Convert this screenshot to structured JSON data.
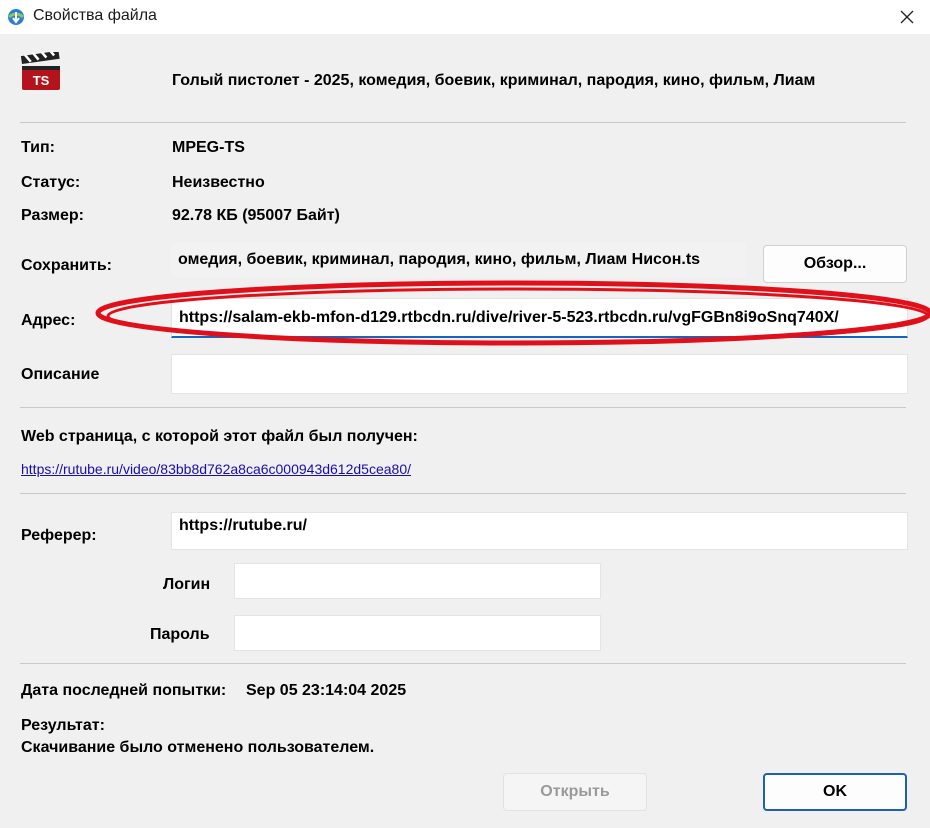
{
  "window": {
    "title": "Свойства файла",
    "app_icon": "idm-globe-icon",
    "close_icon": "close-icon"
  },
  "file": {
    "icon": "ts-clapperboard-icon",
    "icon_text": "TS",
    "title": "Голый пистолет - 2025, комедия, боевик, криминал, пародия, кино, фильм, Лиам"
  },
  "info": {
    "type_label": "Тип:",
    "type_value": "MPEG-TS",
    "status_label": "Статус:",
    "status_value": "Неизвестно",
    "size_label": "Размер:",
    "size_value": "92.78  КБ (95007 Байт)"
  },
  "save": {
    "label": "Сохранить:",
    "value": "омедия, боевик, криминал, пародия, кино, фильм, Лиам Нисон.ts",
    "browse_label": "Обзор..."
  },
  "address": {
    "label": "Адрес:",
    "value": "https://salam-ekb-mfon-d129.rtbcdn.ru/dive/river-5-523.rtbcdn.ru/vgFGBn8i9oSnq740X/"
  },
  "description": {
    "label": "Описание",
    "value": ""
  },
  "webpage": {
    "label": "Web страница, с которой этот файл был получен:",
    "link": "https://rutube.ru/video/83bb8d762a8ca6c000943d612d5cea80/"
  },
  "referrer": {
    "label": "Реферер:",
    "value": "https://rutube.ru/"
  },
  "login": {
    "label": "Логин",
    "value": ""
  },
  "password": {
    "label": "Пароль",
    "value": ""
  },
  "last_attempt": {
    "label": "Дата последней попытки:",
    "value": "Sep 05 23:14:04 2025"
  },
  "result": {
    "label": "Результат:",
    "value": "Скачивание было отменено пользователем."
  },
  "buttons": {
    "open_label": "Открыть",
    "ok_label": "OK"
  },
  "colors": {
    "annotation": "#e0101a",
    "accent": "#1565c0"
  }
}
